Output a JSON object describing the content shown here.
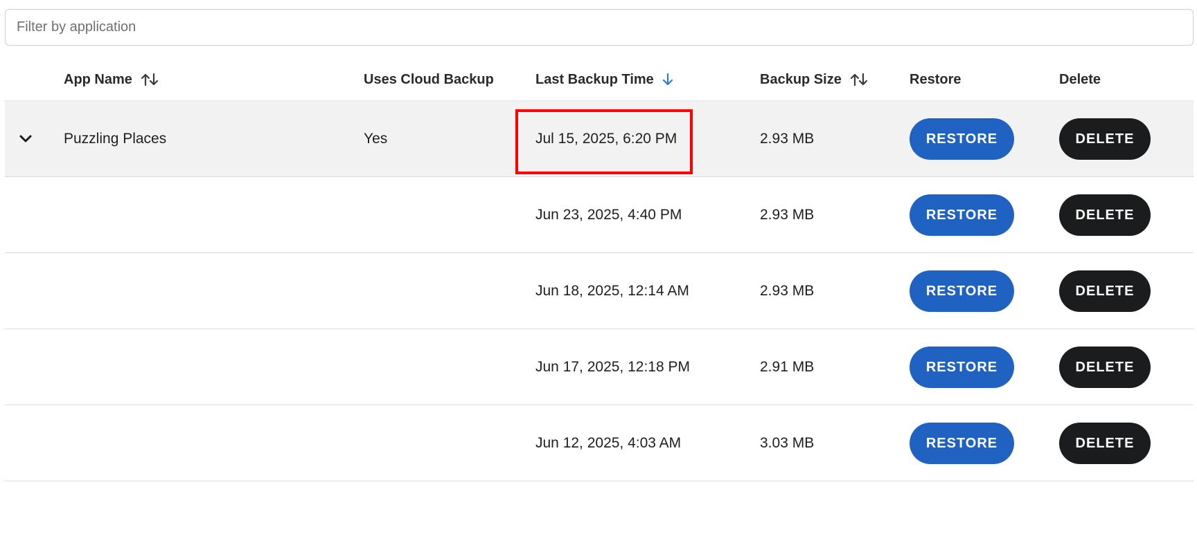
{
  "filter": {
    "placeholder": "Filter by application",
    "value": ""
  },
  "columns": {
    "app_name": "App Name",
    "cloud_backup": "Uses Cloud Backup",
    "last_backup_time": "Last Backup Time",
    "backup_size": "Backup Size",
    "restore": "Restore",
    "delete": "Delete"
  },
  "icons": {
    "app_name_sort": "sort-both-icon",
    "last_backup_sort": "sort-descending-icon",
    "backup_size_sort": "sort-both-icon",
    "expand": "chevron-down-icon"
  },
  "colors": {
    "restore_button": "#1f62c2",
    "delete_button": "#1b1c1e",
    "sort_active": "#2a7bd9",
    "highlight_box": "#ff0000"
  },
  "rows": [
    {
      "app_name": "Puzzling Places",
      "cloud_backup": "Yes",
      "time": "Jul 15, 2025, 6:20 PM",
      "size": "2.93 MB",
      "restore_label": "RESTORE",
      "delete_label": "DELETE"
    },
    {
      "app_name": "",
      "cloud_backup": "",
      "time": "Jun 23, 2025, 4:40 PM",
      "size": "2.93 MB",
      "restore_label": "RESTORE",
      "delete_label": "DELETE"
    },
    {
      "app_name": "",
      "cloud_backup": "",
      "time": "Jun 18, 2025, 12:14 AM",
      "size": "2.93 MB",
      "restore_label": "RESTORE",
      "delete_label": "DELETE"
    },
    {
      "app_name": "",
      "cloud_backup": "",
      "time": "Jun 17, 2025, 12:18 PM",
      "size": "2.91 MB",
      "restore_label": "RESTORE",
      "delete_label": "DELETE"
    },
    {
      "app_name": "",
      "cloud_backup": "",
      "time": "Jun 12, 2025, 4:03 AM",
      "size": "3.03 MB",
      "restore_label": "RESTORE",
      "delete_label": "DELETE"
    }
  ]
}
